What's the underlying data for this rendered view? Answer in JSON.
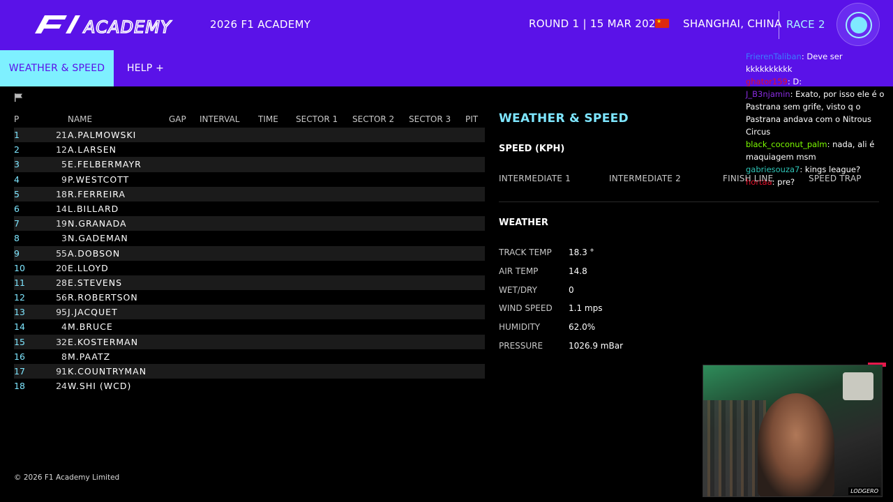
{
  "header": {
    "logo_text": "F1 ACADEMY",
    "event_title": "2026 F1 ACADEMY",
    "round_info": "ROUND 1 | 15 MAR 2026",
    "location": "SHANGHAI, CHINA",
    "session": "RACE 2",
    "flag_country": "China",
    "live_button_icon": "live-indicator-icon"
  },
  "nav": {
    "active_tab": "WEATHER & SPEED",
    "help_label": "HELP  +"
  },
  "chat": [
    {
      "user": "FrierenTaliban",
      "text": ": Deve ser kkkkkkkkkk",
      "color": "#3b7cff"
    },
    {
      "user": "ghator159",
      "text": ": D:",
      "color": "#e0102a"
    },
    {
      "user": "J_B3njamin",
      "text": ": Exato, por isso ele é o Pastrana sem grife, visto q o Pastrana andava com o Nitrous Circus",
      "color": "#8a2be2"
    },
    {
      "user": "black_coconut_palm",
      "text": ": nada, ali é maquiagem msm",
      "color": "#7cfc00"
    },
    {
      "user": "gabriesouza7",
      "text": ": kings league?",
      "color": "#2ec4b6"
    },
    {
      "user": "hortaa",
      "text": ": pre?",
      "color": "#e0102a"
    }
  ],
  "leaderboard": {
    "headers": {
      "p": "P",
      "name": "NAME",
      "gap": "GAP",
      "interval": "INTERVAL",
      "time": "TIME",
      "s1": "SECTOR 1",
      "s2": "SECTOR 2",
      "s3": "SECTOR 3",
      "pit": "PIT"
    },
    "rows": [
      {
        "pos": "1",
        "num": "21",
        "name": "A.PALMOWSKI"
      },
      {
        "pos": "2",
        "num": "12",
        "name": "A.LARSEN"
      },
      {
        "pos": "3",
        "num": "5",
        "name": "E.FELBERMAYR"
      },
      {
        "pos": "4",
        "num": "9",
        "name": "P.WESTCOTT"
      },
      {
        "pos": "5",
        "num": "18",
        "name": "R.FERREIRA"
      },
      {
        "pos": "6",
        "num": "14",
        "name": "L.BILLARD"
      },
      {
        "pos": "7",
        "num": "19",
        "name": "N.GRANADA"
      },
      {
        "pos": "8",
        "num": "3",
        "name": "N.GADEMAN"
      },
      {
        "pos": "9",
        "num": "55",
        "name": "A.DOBSON"
      },
      {
        "pos": "10",
        "num": "20",
        "name": "E.LLOYD"
      },
      {
        "pos": "11",
        "num": "28",
        "name": "E.STEVENS"
      },
      {
        "pos": "12",
        "num": "56",
        "name": "R.ROBERTSON"
      },
      {
        "pos": "13",
        "num": "95",
        "name": "J.JACQUET"
      },
      {
        "pos": "14",
        "num": "4",
        "name": "M.BRUCE"
      },
      {
        "pos": "15",
        "num": "32",
        "name": "E.KOSTERMAN"
      },
      {
        "pos": "16",
        "num": "8",
        "name": "M.PAATZ"
      },
      {
        "pos": "17",
        "num": "91",
        "name": "K.COUNTRYMAN"
      },
      {
        "pos": "18",
        "num": "24",
        "name": "W.SHI (WCD)"
      }
    ]
  },
  "weather_speed": {
    "title": "WEATHER & SPEED",
    "speed_title": "SPEED (KPH)",
    "speed_columns": [
      "INTERMEDIATE 1",
      "INTERMEDIATE 2",
      "FINISH LINE",
      "SPEED TRAP"
    ],
    "weather_title": "WEATHER",
    "weather": [
      {
        "label": "TRACK TEMP",
        "value": "18.3 °"
      },
      {
        "label": "AIR TEMP",
        "value": "14.8"
      },
      {
        "label": "WET/DRY",
        "value": "0"
      },
      {
        "label": "WIND SPEED",
        "value": "1.1 mps"
      },
      {
        "label": "HUMIDITY",
        "value": "62.0%"
      },
      {
        "label": "PRESSURE",
        "value": "1026.9 mBar"
      }
    ]
  },
  "footer": "© 2026 F1 Academy Limited",
  "webcam": {
    "badge": "LODGERO"
  },
  "colors": {
    "brand_purple": "#5a12e8",
    "accent_cyan": "#7ee6ff"
  }
}
